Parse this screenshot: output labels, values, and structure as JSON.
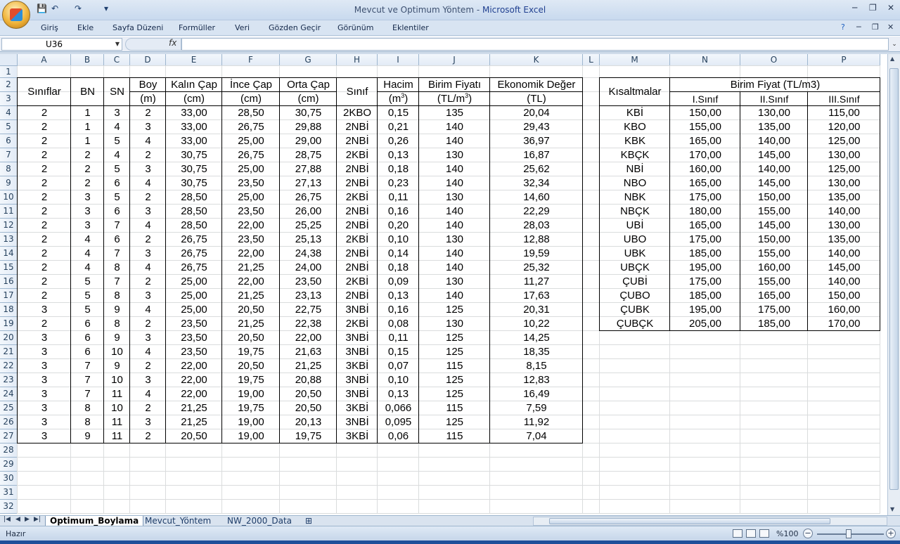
{
  "window": {
    "title": "Mevcut ve Optimum Yöntem",
    "app": "Microsoft Excel",
    "title_sep": " - "
  },
  "qat": {
    "save": "💾",
    "undo": "↶",
    "redo": "↷",
    "more": "▾"
  },
  "ribbon": {
    "tabs": [
      "Giriş",
      "Ekle",
      "Sayfa Düzeni",
      "Formüller",
      "Veri",
      "Gözden Geçir",
      "Görünüm",
      "Eklentiler"
    ]
  },
  "formula_bar": {
    "name_box": "U36",
    "fx": "fx",
    "formula": ""
  },
  "columns": [
    "A",
    "B",
    "C",
    "D",
    "E",
    "F",
    "G",
    "H",
    "I",
    "J",
    "K",
    "L",
    "M",
    "N",
    "O",
    "P"
  ],
  "rows": [
    "1",
    "2",
    "3",
    "4",
    "5",
    "6",
    "7",
    "8",
    "9",
    "10",
    "11",
    "12",
    "13",
    "14",
    "15",
    "16",
    "17",
    "18",
    "19",
    "20",
    "21",
    "22",
    "23",
    "24",
    "25",
    "26",
    "27",
    "28",
    "29",
    "30",
    "31",
    "32"
  ],
  "main_table": {
    "headers": {
      "siniflar": "Sınıflar",
      "bn": "BN",
      "sn": "SN",
      "boy": "Boy",
      "kalin": "Kalın Çap",
      "ince": "İnce Çap",
      "orta": "Orta Çap",
      "sinif": "Sınıf",
      "hacim": "Hacim",
      "birim": "Birim Fiyatı",
      "ekonomik": "Ekonomik Değer"
    },
    "units": {
      "boy": "(m)",
      "kalin": "(cm)",
      "ince": "(cm)",
      "orta": "(cm)",
      "hacim": "(m",
      "hacim_exp": "3",
      "hacim_close": ")",
      "birim": "(TL/m",
      "birim_exp": "3",
      "birim_close": ")",
      "ekonomik": "(TL)"
    },
    "rows": [
      [
        "2",
        "1",
        "3",
        "2",
        "33,00",
        "28,50",
        "30,75",
        "2KBO",
        "0,15",
        "135",
        "20,04"
      ],
      [
        "2",
        "1",
        "4",
        "3",
        "33,00",
        "26,75",
        "29,88",
        "2NBİ",
        "0,21",
        "140",
        "29,43"
      ],
      [
        "2",
        "1",
        "5",
        "4",
        "33,00",
        "25,00",
        "29,00",
        "2NBİ",
        "0,26",
        "140",
        "36,97"
      ],
      [
        "2",
        "2",
        "4",
        "2",
        "30,75",
        "26,75",
        "28,75",
        "2KBİ",
        "0,13",
        "130",
        "16,87"
      ],
      [
        "2",
        "2",
        "5",
        "3",
        "30,75",
        "25,00",
        "27,88",
        "2NBİ",
        "0,18",
        "140",
        "25,62"
      ],
      [
        "2",
        "2",
        "6",
        "4",
        "30,75",
        "23,50",
        "27,13",
        "2NBİ",
        "0,23",
        "140",
        "32,34"
      ],
      [
        "2",
        "3",
        "5",
        "2",
        "28,50",
        "25,00",
        "26,75",
        "2KBİ",
        "0,11",
        "130",
        "14,60"
      ],
      [
        "2",
        "3",
        "6",
        "3",
        "28,50",
        "23,50",
        "26,00",
        "2NBİ",
        "0,16",
        "140",
        "22,29"
      ],
      [
        "2",
        "3",
        "7",
        "4",
        "28,50",
        "22,00",
        "25,25",
        "2NBİ",
        "0,20",
        "140",
        "28,03"
      ],
      [
        "2",
        "4",
        "6",
        "2",
        "26,75",
        "23,50",
        "25,13",
        "2KBİ",
        "0,10",
        "130",
        "12,88"
      ],
      [
        "2",
        "4",
        "7",
        "3",
        "26,75",
        "22,00",
        "24,38",
        "2NBİ",
        "0,14",
        "140",
        "19,59"
      ],
      [
        "2",
        "4",
        "8",
        "4",
        "26,75",
        "21,25",
        "24,00",
        "2NBİ",
        "0,18",
        "140",
        "25,32"
      ],
      [
        "2",
        "5",
        "7",
        "2",
        "25,00",
        "22,00",
        "23,50",
        "2KBİ",
        "0,09",
        "130",
        "11,27"
      ],
      [
        "2",
        "5",
        "8",
        "3",
        "25,00",
        "21,25",
        "23,13",
        "2NBİ",
        "0,13",
        "140",
        "17,63"
      ],
      [
        "3",
        "5",
        "9",
        "4",
        "25,00",
        "20,50",
        "22,75",
        "3NBİ",
        "0,16",
        "125",
        "20,31"
      ],
      [
        "2",
        "6",
        "8",
        "2",
        "23,50",
        "21,25",
        "22,38",
        "2KBİ",
        "0,08",
        "130",
        "10,22"
      ],
      [
        "3",
        "6",
        "9",
        "3",
        "23,50",
        "20,50",
        "22,00",
        "3NBİ",
        "0,11",
        "125",
        "14,25"
      ],
      [
        "3",
        "6",
        "10",
        "4",
        "23,50",
        "19,75",
        "21,63",
        "3NBİ",
        "0,15",
        "125",
        "18,35"
      ],
      [
        "3",
        "7",
        "9",
        "2",
        "22,00",
        "20,50",
        "21,25",
        "3KBİ",
        "0,07",
        "115",
        "8,15"
      ],
      [
        "3",
        "7",
        "10",
        "3",
        "22,00",
        "19,75",
        "20,88",
        "3NBİ",
        "0,10",
        "125",
        "12,83"
      ],
      [
        "3",
        "7",
        "11",
        "4",
        "22,00",
        "19,00",
        "20,50",
        "3NBİ",
        "0,13",
        "125",
        "16,49"
      ],
      [
        "3",
        "8",
        "10",
        "2",
        "21,25",
        "19,75",
        "20,50",
        "3KBİ",
        "0,066",
        "115",
        "7,59"
      ],
      [
        "3",
        "8",
        "11",
        "3",
        "21,25",
        "19,00",
        "20,13",
        "3NBİ",
        "0,095",
        "125",
        "11,92"
      ],
      [
        "3",
        "9",
        "11",
        "2",
        "20,50",
        "19,00",
        "19,75",
        "3KBİ",
        "0,06",
        "115",
        "7,04"
      ]
    ]
  },
  "price_table": {
    "headers": {
      "kisaltmalar": "Kısaltmalar",
      "birim_fiyat": "Birim Fiyat (TL/m3)",
      "sinif1": "I.Sınıf",
      "sinif2": "II.Sınıf",
      "sinif3": "III.Sınıf"
    },
    "rows": [
      [
        "KBİ",
        "150,00",
        "130,00",
        "115,00"
      ],
      [
        "KBO",
        "155,00",
        "135,00",
        "120,00"
      ],
      [
        "KBK",
        "165,00",
        "140,00",
        "125,00"
      ],
      [
        "KBÇK",
        "170,00",
        "145,00",
        "130,00"
      ],
      [
        "NBİ",
        "160,00",
        "140,00",
        "125,00"
      ],
      [
        "NBO",
        "165,00",
        "145,00",
        "130,00"
      ],
      [
        "NBK",
        "175,00",
        "150,00",
        "135,00"
      ],
      [
        "NBÇK",
        "180,00",
        "155,00",
        "140,00"
      ],
      [
        "UBİ",
        "165,00",
        "145,00",
        "130,00"
      ],
      [
        "UBO",
        "175,00",
        "150,00",
        "135,00"
      ],
      [
        "UBK",
        "185,00",
        "155,00",
        "140,00"
      ],
      [
        "UBÇK",
        "195,00",
        "160,00",
        "145,00"
      ],
      [
        "ÇUBİ",
        "175,00",
        "155,00",
        "140,00"
      ],
      [
        "ÇUBO",
        "185,00",
        "165,00",
        "150,00"
      ],
      [
        "ÇUBK",
        "195,00",
        "175,00",
        "160,00"
      ],
      [
        "ÇUBÇK",
        "205,00",
        "185,00",
        "170,00"
      ]
    ]
  },
  "sheets": [
    "Optimum_Boylama",
    "Mevcut_Yöntem",
    "NW_2000_Data"
  ],
  "active_sheet": "Optimum_Boylama",
  "status": {
    "text": "Hazır",
    "zoom": "%100"
  },
  "colors": {
    "accent": "#1f3f8f",
    "grid": "#dadcdd",
    "header_bg": "#e2ebf6"
  }
}
